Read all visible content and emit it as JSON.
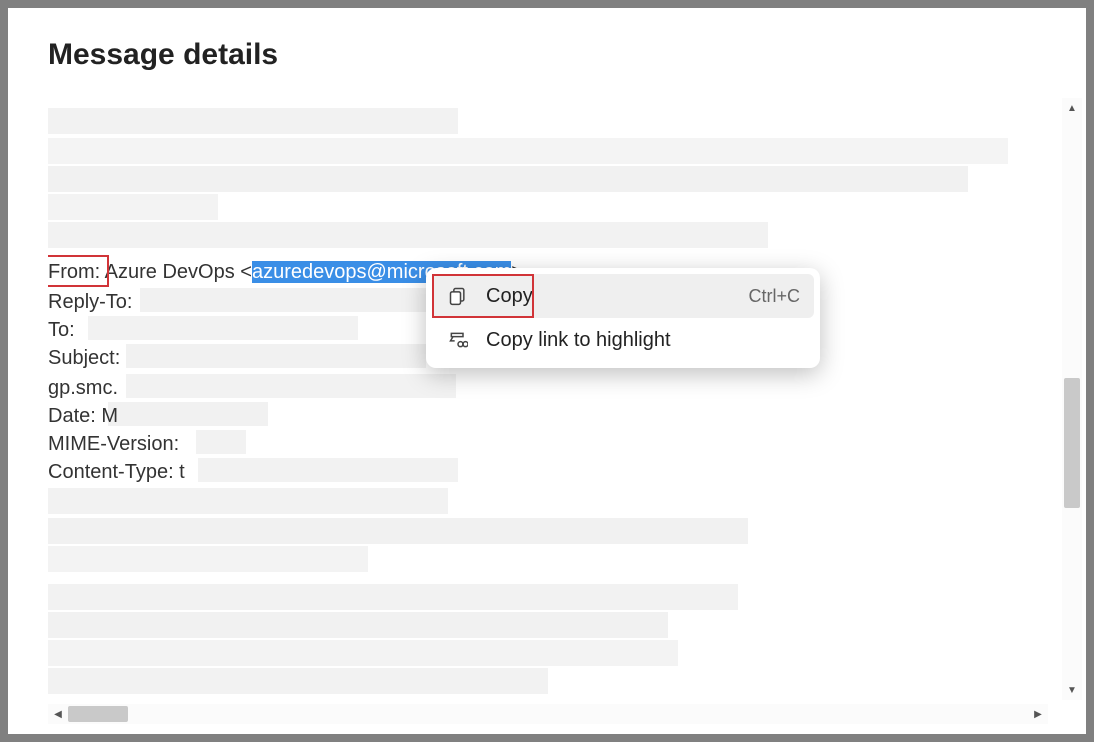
{
  "dialog": {
    "title": "Message details"
  },
  "headers": {
    "from_label": "From:",
    "from_name": "Azure DevOps",
    "from_email": "azuredevops@microsoft.com",
    "reply_to_label": "Reply-To:",
    "to_label": "To:",
    "subject_label": "Subject:",
    "date_label_prefix": "Date: M",
    "mime_label": "MIME-Version:",
    "content_type_prefix": "Content-Type: t"
  },
  "context_menu": {
    "items": [
      {
        "label": "Copy",
        "shortcut": "Ctrl+C"
      },
      {
        "label": "Copy link to highlight",
        "shortcut": ""
      }
    ]
  },
  "fragments": {
    "gp_smc": " gp.smc."
  }
}
